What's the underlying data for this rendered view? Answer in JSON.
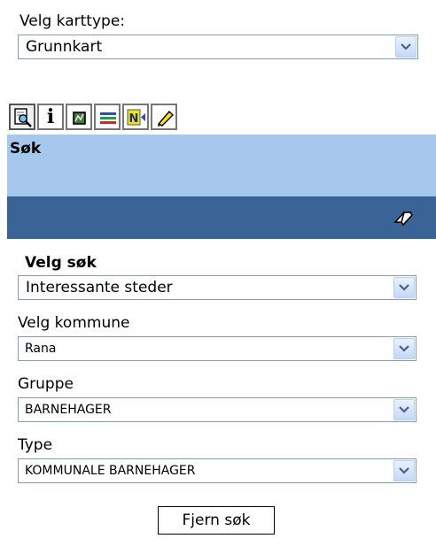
{
  "map_type": {
    "label": "Velg karttype:",
    "selected": "Grunnkart"
  },
  "toolbar": {
    "tools": [
      "search-icon",
      "info-icon",
      "map-icon",
      "layers-icon",
      "north-arrow-icon",
      "pencil-icon"
    ],
    "active_tool": "search-icon",
    "info_glyph": "i",
    "north_letter": "N"
  },
  "search_panel": {
    "title": "Søk",
    "clear_icon": "eraser-icon",
    "header_color": "#a6c8ec",
    "bar_color": "#3a6496"
  },
  "search_form": {
    "search_label": "Velg søk",
    "search_selected": "Interessante steder",
    "kommune_label": "Velg kommune",
    "kommune_selected": "Rana",
    "gruppe_label": "Gruppe",
    "gruppe_selected": "BARNEHAGER",
    "type_label": "Type",
    "type_selected": "KOMMUNALE BARNEHAGER",
    "clear_button": "Fjern søk"
  }
}
